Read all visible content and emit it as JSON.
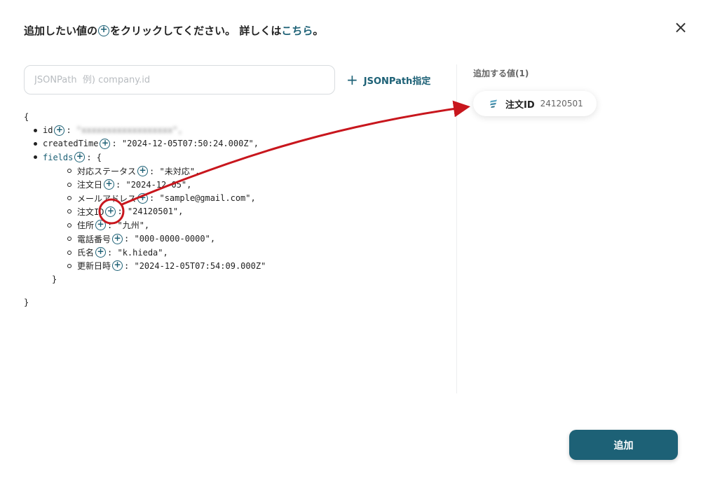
{
  "header": {
    "part1": "追加したい値の",
    "part2": "をクリックしてください。 詳しくは",
    "link": "こちら",
    "part3": "。"
  },
  "search": {
    "placeholder": "JSONPath  例) company.id"
  },
  "jsonpath_button": {
    "plus": "+",
    "label": "JSONPath指定"
  },
  "plus_glyph": "+",
  "code": {
    "open_brace": "{",
    "close_brace": "}",
    "fields_close": "}",
    "root": [
      {
        "key": "id",
        "value": "\"xxxxxxxxxxxxxxxxxx\",",
        "blurred": true
      },
      {
        "key": "createdTime",
        "value": ": \"2024-12-05T07:50:24.000Z\","
      },
      {
        "key": "fields",
        "value": ": {"
      }
    ],
    "fields": [
      {
        "key": "対応ステータス",
        "value": ": \"未対応\","
      },
      {
        "key": "注文日",
        "value": ": \"2024-12-05\","
      },
      {
        "key": "メールアドレス",
        "value": ": \"sample@gmail.com\","
      },
      {
        "key": "注文ID",
        "value": ": \"24120501\","
      },
      {
        "key": "住所",
        "value": ": \"九州\","
      },
      {
        "key": "電話番号",
        "value": ": \"000-0000-0000\","
      },
      {
        "key": "氏名",
        "value": ": \"k.hieda\","
      },
      {
        "key": "更新日時",
        "value": ": \"2024-12-05T07:54:09.000Z\""
      }
    ]
  },
  "right": {
    "title": "追加する値(1)",
    "chip": {
      "label": "注文ID",
      "value": "24120501",
      "icon": "stack-icon"
    }
  },
  "submit": {
    "label": "追加"
  },
  "colors": {
    "accent": "#1d6176",
    "annotation": "#c8161d"
  }
}
